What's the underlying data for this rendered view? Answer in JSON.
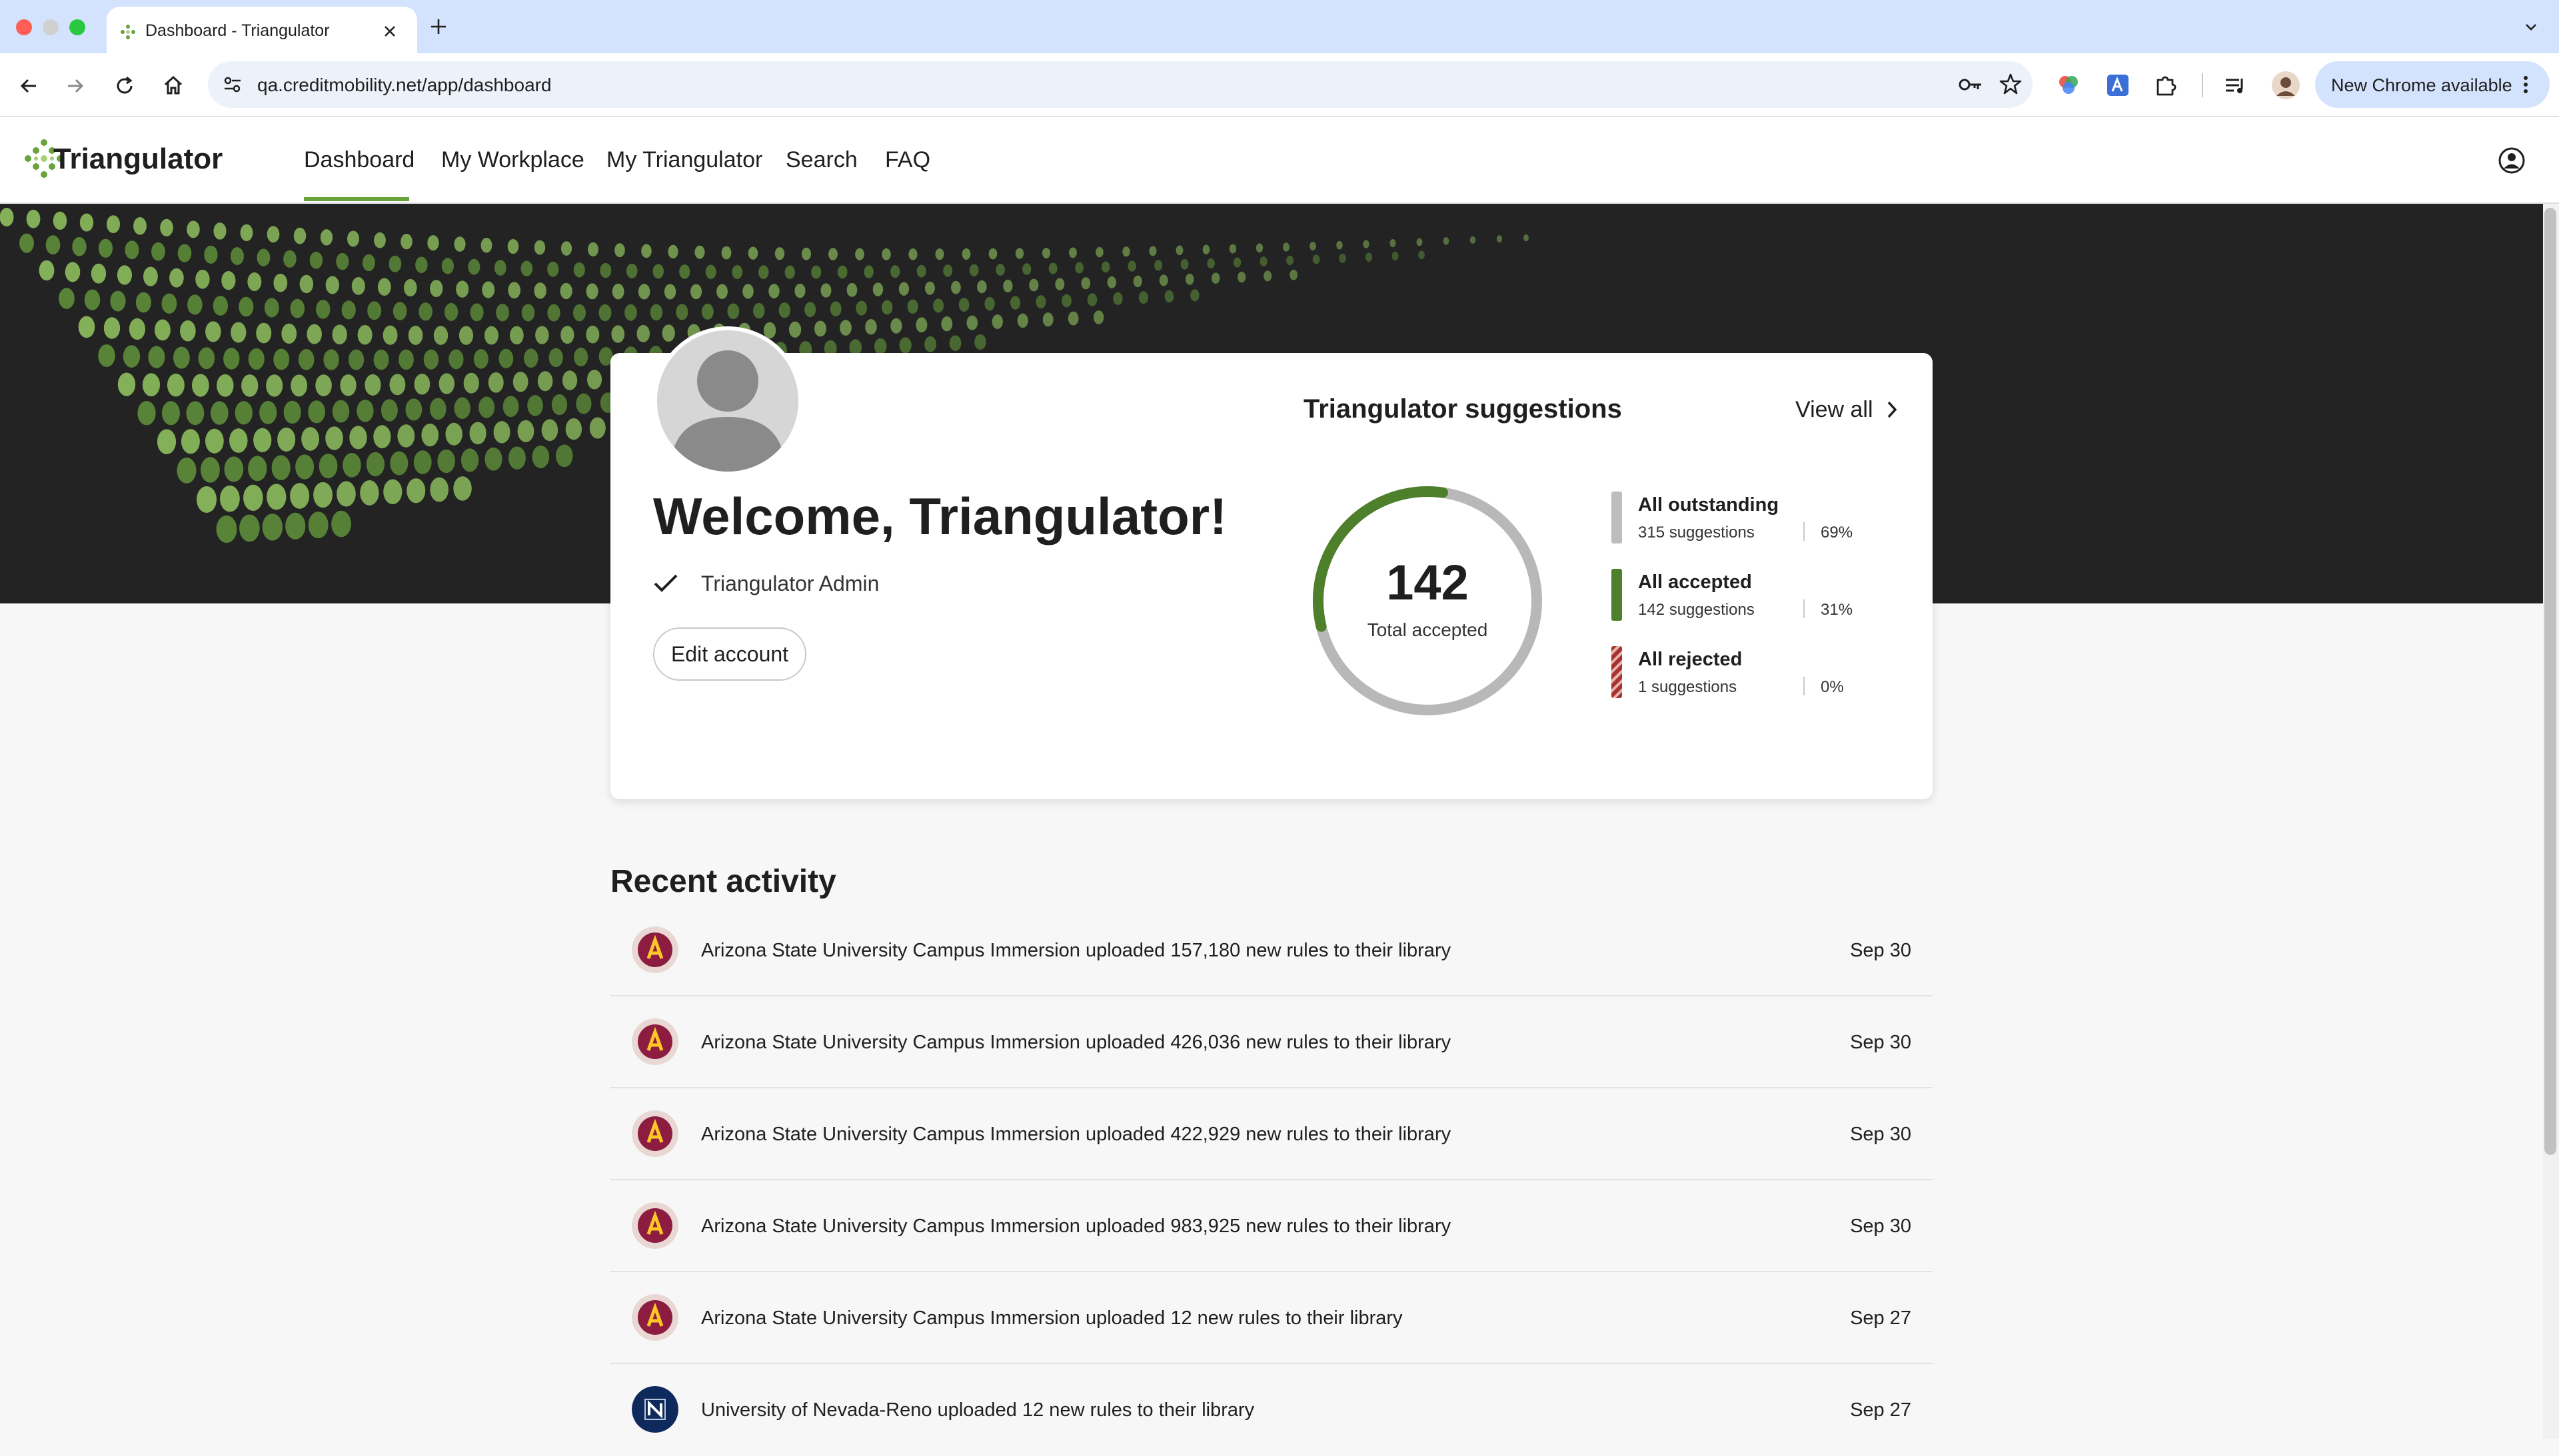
{
  "browser": {
    "tab_title": "Dashboard - Triangulator",
    "url": "qa.creditmobility.net/app/dashboard",
    "update_label": "New Chrome available"
  },
  "app": {
    "brand": "Triangulator",
    "accent_color": "#6aa33c",
    "nav": [
      {
        "label": "Dashboard",
        "active": true
      },
      {
        "label": "My Workplace"
      },
      {
        "label": "My Triangulator"
      },
      {
        "label": "Search"
      },
      {
        "label": "FAQ"
      }
    ]
  },
  "profile": {
    "welcome": "Welcome, Triangulator!",
    "role": "Triangulator Admin",
    "edit_label": "Edit account"
  },
  "suggestions": {
    "title": "Triangulator suggestions",
    "view_all": "View all",
    "total_value": "142",
    "total_label": "Total accepted",
    "accepted_fraction": 0.31,
    "legend": [
      {
        "title": "All outstanding",
        "count": "315 suggestions",
        "pct": "69%",
        "color": "#bdbdbd"
      },
      {
        "title": "All accepted",
        "count": "142 suggestions",
        "pct": "31%",
        "color": "#4e7f2a"
      },
      {
        "title": "All rejected",
        "count": "1 suggestions",
        "pct": "0%",
        "color": "#a8322d"
      }
    ]
  },
  "activity": {
    "title": "Recent activity",
    "items": [
      {
        "text": "Arizona State University Campus Immersion uploaded 157,180 new rules to their library",
        "date": "Sep 30",
        "icon": "asu-logo-icon"
      },
      {
        "text": "Arizona State University Campus Immersion uploaded 426,036 new rules to their library",
        "date": "Sep 30",
        "icon": "asu-logo-icon"
      },
      {
        "text": "Arizona State University Campus Immersion uploaded 422,929 new rules to their library",
        "date": "Sep 30",
        "icon": "asu-logo-icon"
      },
      {
        "text": "Arizona State University Campus Immersion uploaded 983,925 new rules to their library",
        "date": "Sep 30",
        "icon": "asu-logo-icon"
      },
      {
        "text": "Arizona State University Campus Immersion uploaded 12 new rules to their library",
        "date": "Sep 27",
        "icon": "asu-logo-icon"
      },
      {
        "text": "University of Nevada-Reno uploaded 12 new rules to their library",
        "date": "Sep 27",
        "icon": "unr-logo-icon"
      }
    ]
  }
}
